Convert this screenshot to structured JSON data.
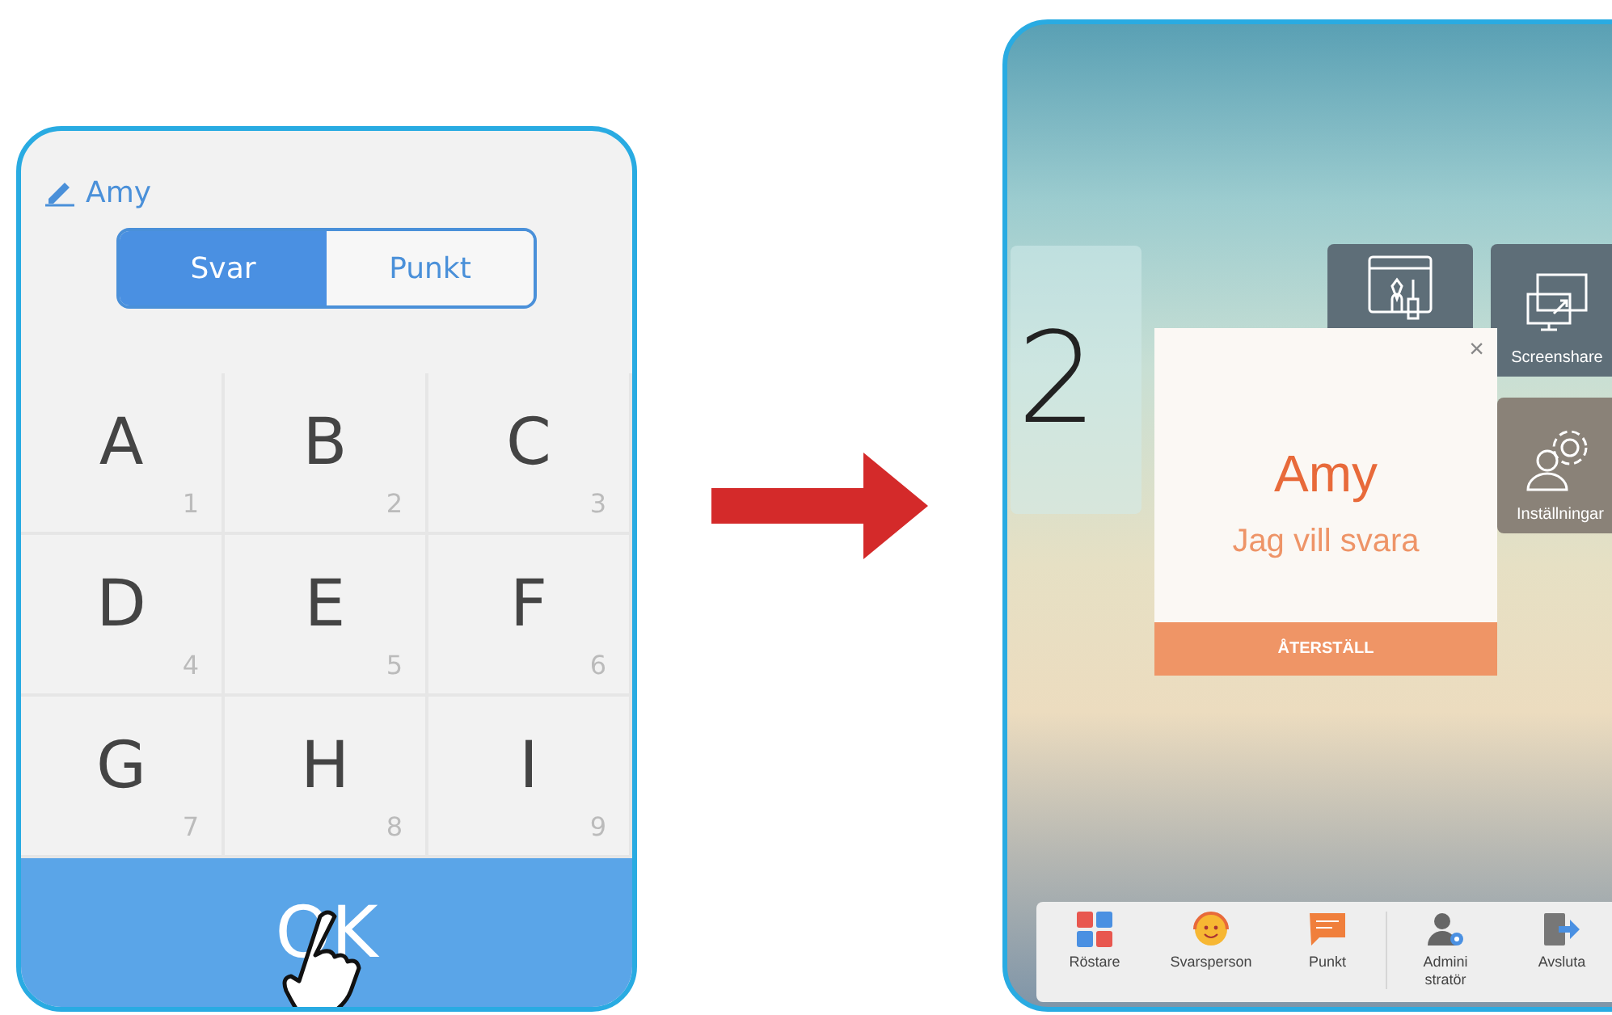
{
  "left_screen": {
    "user": "Amy",
    "mode_tabs": [
      {
        "label": "Svar",
        "selected": true
      },
      {
        "label": "Punkt",
        "selected": false
      }
    ],
    "keys": [
      {
        "letter": "A",
        "number": "1"
      },
      {
        "letter": "B",
        "number": "2"
      },
      {
        "letter": "C",
        "number": "3"
      },
      {
        "letter": "D",
        "number": "4"
      },
      {
        "letter": "E",
        "number": "5"
      },
      {
        "letter": "F",
        "number": "6"
      },
      {
        "letter": "G",
        "number": "7"
      },
      {
        "letter": "H",
        "number": "8"
      },
      {
        "letter": "I",
        "number": "9"
      }
    ],
    "ok_button": "OK"
  },
  "right_screen": {
    "tiles": [
      {
        "kind": "number",
        "label": "2"
      },
      {
        "kind": "paint"
      },
      {
        "kind": "screenshare",
        "label": "Screenshare"
      },
      {
        "kind": "settings",
        "label": "Inställningar"
      }
    ],
    "dialog": {
      "close": "×",
      "name": "Amy",
      "message": "Jag vill svara",
      "button": "ÅTERSTÄLL"
    },
    "toolbar": [
      {
        "kind": "abcd",
        "label": "Röstare"
      },
      {
        "kind": "face",
        "label": "Svarsperson"
      },
      {
        "kind": "chat",
        "label": "Punkt"
      },
      {
        "kind": "admin",
        "label": "Admini\nstratör"
      },
      {
        "kind": "exit",
        "label": "Avsluta"
      }
    ]
  }
}
